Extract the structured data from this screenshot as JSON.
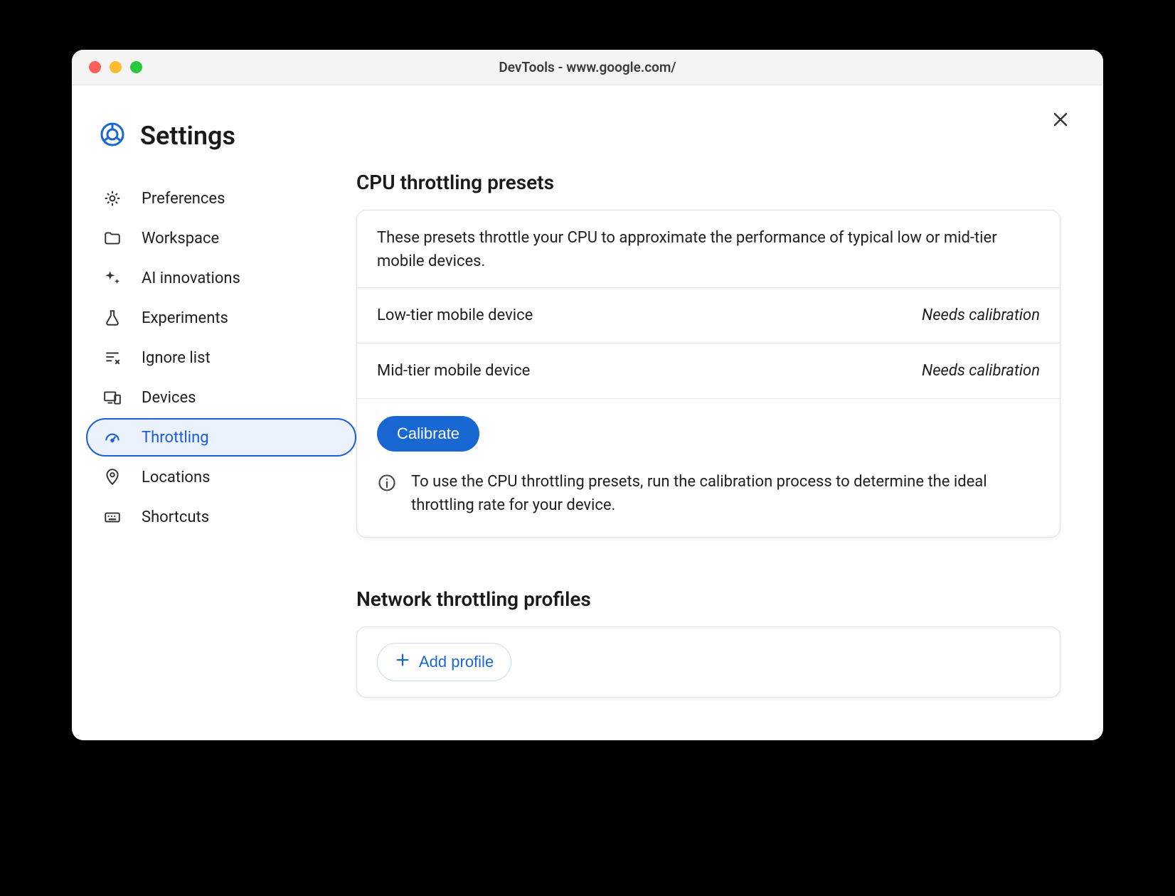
{
  "window": {
    "title": "DevTools - www.google.com/"
  },
  "settings": {
    "title": "Settings",
    "sidebar": {
      "items": [
        {
          "label": "Preferences"
        },
        {
          "label": "Workspace"
        },
        {
          "label": "AI innovations"
        },
        {
          "label": "Experiments"
        },
        {
          "label": "Ignore list"
        },
        {
          "label": "Devices"
        },
        {
          "label": "Throttling"
        },
        {
          "label": "Locations"
        },
        {
          "label": "Shortcuts"
        }
      ],
      "active_index": 6
    }
  },
  "main": {
    "cpu_section": {
      "title": "CPU throttling presets",
      "description": "These presets throttle your CPU to approximate the performance of typical low or mid-tier mobile devices.",
      "presets": [
        {
          "name": "Low-tier mobile device",
          "status": "Needs calibration"
        },
        {
          "name": "Mid-tier mobile device",
          "status": "Needs calibration"
        }
      ],
      "calibrate_label": "Calibrate",
      "info_text": "To use the CPU throttling presets, run the calibration process to determine the ideal throttling rate for your device."
    },
    "network_section": {
      "title": "Network throttling profiles",
      "add_profile_label": "Add profile"
    }
  }
}
